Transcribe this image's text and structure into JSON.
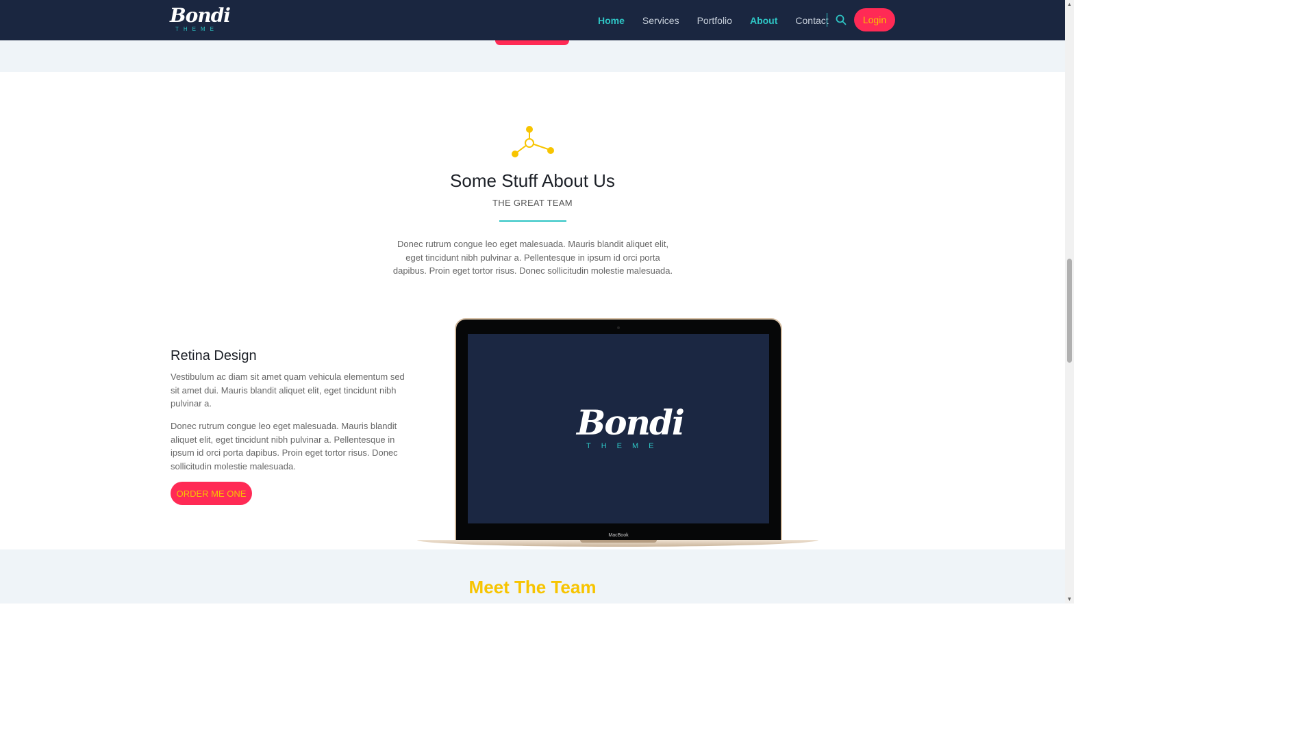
{
  "header": {
    "logo_text": "Bondi",
    "logo_sub": "THEME",
    "nav": [
      {
        "label": "Home"
      },
      {
        "label": "Services"
      },
      {
        "label": "Portfolio"
      },
      {
        "label": "About"
      },
      {
        "label": "Contact"
      }
    ],
    "search_icon": "search-icon",
    "login_label": "Login"
  },
  "about": {
    "icon": "network-icon",
    "title": "Some Stuff About Us",
    "subtitle": "THE GREAT TEAM",
    "text": "Donec rutrum congue leo eget malesuada. Mauris blandit aliquet elit, eget tincidunt nibh pulvinar a. Pellentesque in ipsum id orci porta dapibus. Proin eget tortor risus. Donec sollicitudin molestie malesuada."
  },
  "feature": {
    "title": "Retina Design",
    "p1": "Vestibulum ac diam sit amet quam vehicula elementum sed sit amet dui. Mauris blandit aliquet elit, eget tincidunt nibh pulvinar a.",
    "p2": "Donec rutrum congue leo eget malesuada. Mauris blandit aliquet elit, eget tincidunt nibh pulvinar a. Pellentesque in ipsum id orci porta dapibus. Proin eget tortor risus. Donec sollicitudin molestie malesuada.",
    "button_label": "ORDER ME ONE"
  },
  "laptop": {
    "brand": "MacBook",
    "screen_logo_text": "Bondi",
    "screen_logo_sub": "THEME"
  },
  "team": {
    "title": "Meet The Team"
  },
  "colors": {
    "nav_bg": "#1a2640",
    "accent_teal": "#2ec4c4",
    "accent_pink": "#ff2a55",
    "accent_yellow": "#f7c400",
    "light_section_bg": "#eff4f8"
  }
}
